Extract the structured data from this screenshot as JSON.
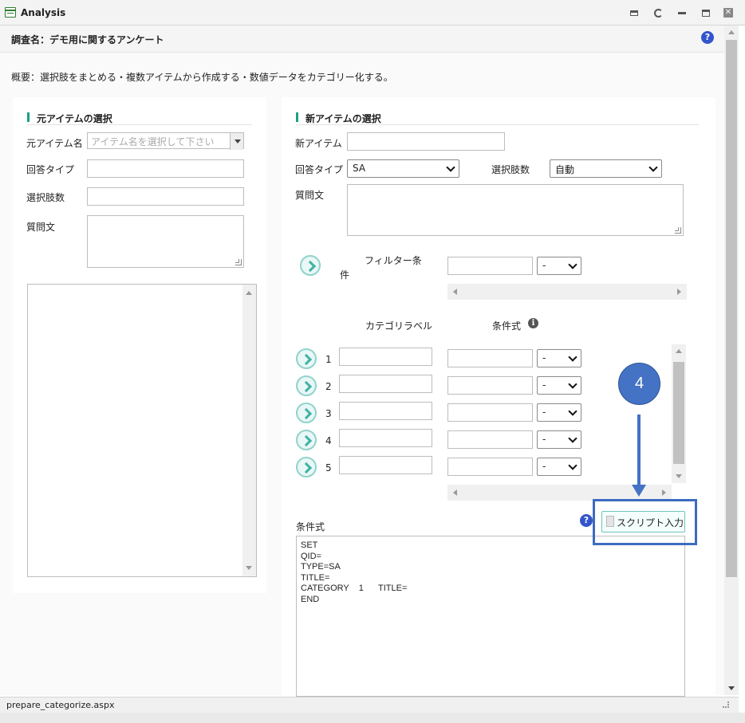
{
  "window": {
    "title": "Analysis"
  },
  "header": {
    "survey_title": "調査名：デモ用に関するアンケート",
    "summary": "概要：選択肢をまとめる・複数アイテムから作成する・数値データをカテゴリー化する。"
  },
  "source_panel": {
    "section_title": "元アイテムの選択",
    "item_name_label": "元アイテム名",
    "item_name_placeholder": "アイテム名を選択して下さい",
    "answer_type_label": "回答タイプ",
    "choice_count_label": "選択肢数",
    "question_label": "質問文"
  },
  "new_panel": {
    "section_title": "新アイテムの選択",
    "new_item_label": "新アイテム",
    "answer_type_label": "回答タイプ",
    "answer_type_value": "SA",
    "choice_count_label": "選択肢数",
    "choice_count_value": "自動",
    "question_label": "質問文",
    "filter_label_line1": "フィルター条",
    "filter_label_line2": "件",
    "filter_op": "-",
    "category_label_header": "カテゴリラベル",
    "condition_header": "条件式",
    "info_glyph": "i",
    "rows": [
      {
        "num": "1",
        "op": "-"
      },
      {
        "num": "2",
        "op": "-"
      },
      {
        "num": "3",
        "op": "-"
      },
      {
        "num": "4",
        "op": "-"
      },
      {
        "num": "5",
        "op": "-"
      }
    ],
    "condition_label": "条件式",
    "help_glyph": "?",
    "script_button": "スクリプト入力",
    "script_text": "SET\nQID=\nTYPE=SA\nTITLE=\nCATEGORY    1      TITLE=\nEND"
  },
  "annotation": {
    "callout_number": "4"
  },
  "status": {
    "text": "prepare_categorize.aspx"
  },
  "colors": {
    "accent": "#1e9e88",
    "callout": "#4472c4",
    "help": "#3355cc"
  }
}
